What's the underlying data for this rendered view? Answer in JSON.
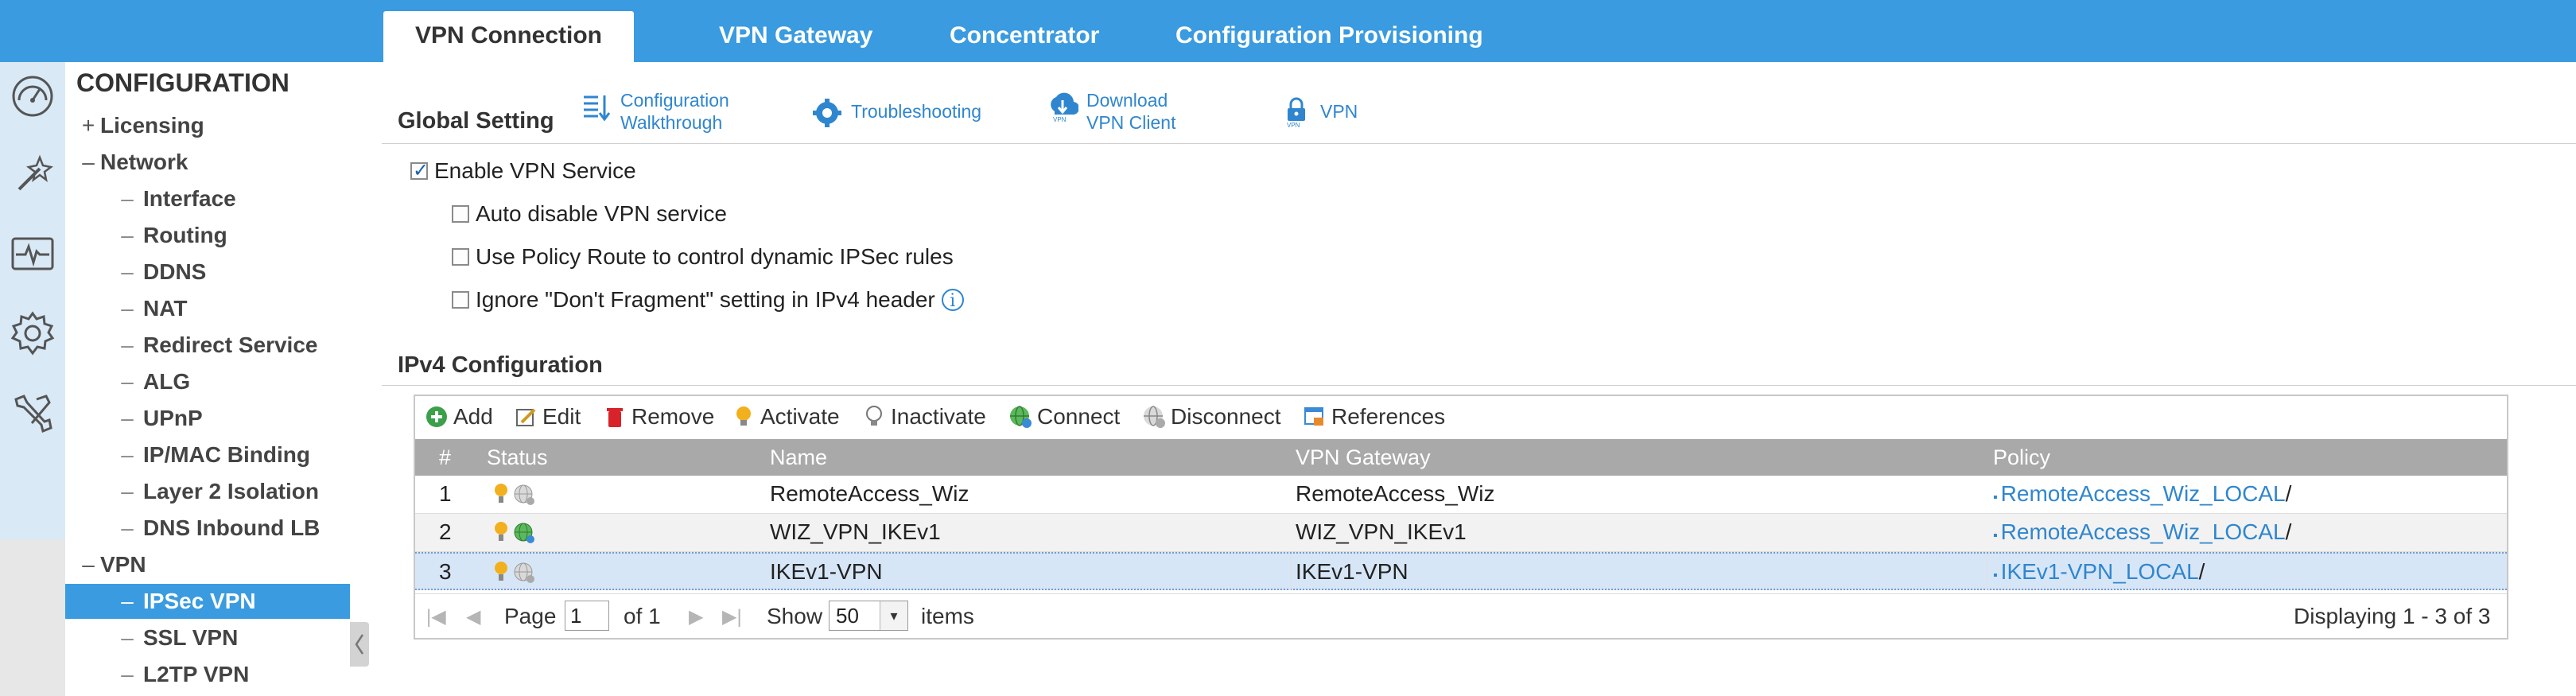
{
  "top_tabs": [
    {
      "label": "VPN Connection",
      "active": true
    },
    {
      "label": "VPN Gateway"
    },
    {
      "label": "Concentrator"
    },
    {
      "label": "Configuration Provisioning"
    }
  ],
  "rail_icons": [
    "dashboard-icon",
    "wizard-icon",
    "monitor-icon",
    "configuration-gear-icon",
    "maintenance-tools-icon"
  ],
  "sidebar": {
    "title": "CONFIGURATION",
    "items": [
      {
        "label": "Licensing",
        "glyph": "+"
      },
      {
        "label": "Network",
        "glyph": "–"
      },
      {
        "label": "Interface",
        "glyph": "–"
      },
      {
        "label": "Routing",
        "glyph": "–"
      },
      {
        "label": "DDNS",
        "glyph": "–"
      },
      {
        "label": "NAT",
        "glyph": "–"
      },
      {
        "label": "Redirect Service",
        "glyph": "–"
      },
      {
        "label": "ALG",
        "glyph": "–"
      },
      {
        "label": "UPnP",
        "glyph": "–"
      },
      {
        "label": "IP/MAC Binding",
        "glyph": "–"
      },
      {
        "label": "Layer 2 Isolation",
        "glyph": "–"
      },
      {
        "label": "DNS Inbound LB",
        "glyph": "–"
      },
      {
        "label": "VPN",
        "glyph": "–"
      },
      {
        "label": "IPSec VPN",
        "glyph": "–",
        "selected": true
      },
      {
        "label": "SSL VPN",
        "glyph": "–"
      },
      {
        "label": "L2TP VPN",
        "glyph": "–"
      }
    ]
  },
  "global_setting": {
    "title": "Global Setting",
    "links": [
      {
        "line1": "Configuration",
        "line2": "Walkthrough",
        "icon": "walkthrough-icon"
      },
      {
        "line1": "Troubleshooting",
        "line2": "",
        "icon": "troubleshooting-gear-icon"
      },
      {
        "line1": "Download",
        "line2": "VPN Client",
        "icon": "download-client-icon"
      },
      {
        "line1": "VPN",
        "line2": "",
        "icon": "vpn-lock-icon"
      }
    ],
    "options": [
      {
        "label": "Enable VPN Service",
        "checked": true
      },
      {
        "label": "Auto disable VPN service",
        "checked": false
      },
      {
        "label": "Use Policy Route to control dynamic IPSec rules",
        "checked": false
      },
      {
        "label": "Ignore \"Don't Fragment\" setting in IPv4 header",
        "checked": false,
        "info": true
      }
    ]
  },
  "ipv4": {
    "title": "IPv4 Configuration",
    "toolbar": [
      "Add",
      "Edit",
      "Remove",
      "Activate",
      "Inactivate",
      "Connect",
      "Disconnect",
      "References"
    ],
    "columns": [
      "#",
      "Status",
      "Name",
      "VPN Gateway",
      "Policy"
    ],
    "rows": [
      {
        "num": "1",
        "name": "RemoteAccess_Wiz",
        "gateway": "RemoteAccess_Wiz",
        "policy": "RemoteAccess_Wiz_LOCAL",
        "policy_suffix": "/",
        "connected": false
      },
      {
        "num": "2",
        "name": "WIZ_VPN_IKEv1",
        "gateway": "WIZ_VPN_IKEv1",
        "policy": "RemoteAccess_Wiz_LOCAL",
        "policy_suffix": "/",
        "connected": true
      },
      {
        "num": "3",
        "name": "IKEv1-VPN",
        "gateway": "IKEv1-VPN",
        "policy": "IKEv1-VPN_LOCAL",
        "policy_suffix": "/",
        "connected": false
      }
    ],
    "paging": {
      "page_label": "Page",
      "page_value": "1",
      "of_label": "of 1",
      "show_label": "Show",
      "page_size": "50",
      "items_label": "items",
      "displaying": "Displaying 1 - 3 of 3"
    }
  },
  "colors": {
    "brand_blue": "#3a9be0",
    "link_blue": "#2f86cf",
    "header_gray": "#a9a9a9",
    "selected_row": "#d7e6f7"
  }
}
